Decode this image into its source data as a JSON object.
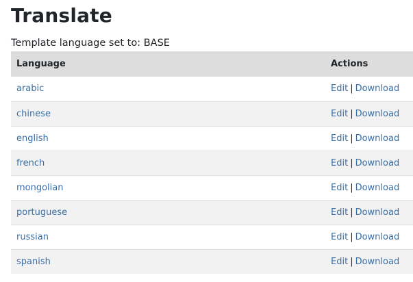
{
  "page": {
    "title": "Translate",
    "template_label": "Template language set to: BASE"
  },
  "table": {
    "headers": {
      "language": "Language",
      "actions": "Actions"
    },
    "edit_label": "Edit",
    "separator": "|",
    "download_label": "Download",
    "rows": [
      {
        "language": "arabic"
      },
      {
        "language": "chinese"
      },
      {
        "language": "english"
      },
      {
        "language": "french"
      },
      {
        "language": "mongolian"
      },
      {
        "language": "portuguese"
      },
      {
        "language": "russian"
      },
      {
        "language": "spanish"
      }
    ]
  },
  "colors": {
    "link": "#3a6ea5",
    "header_bg": "#dddddd",
    "stripe_bg": "#f2f2f2"
  }
}
